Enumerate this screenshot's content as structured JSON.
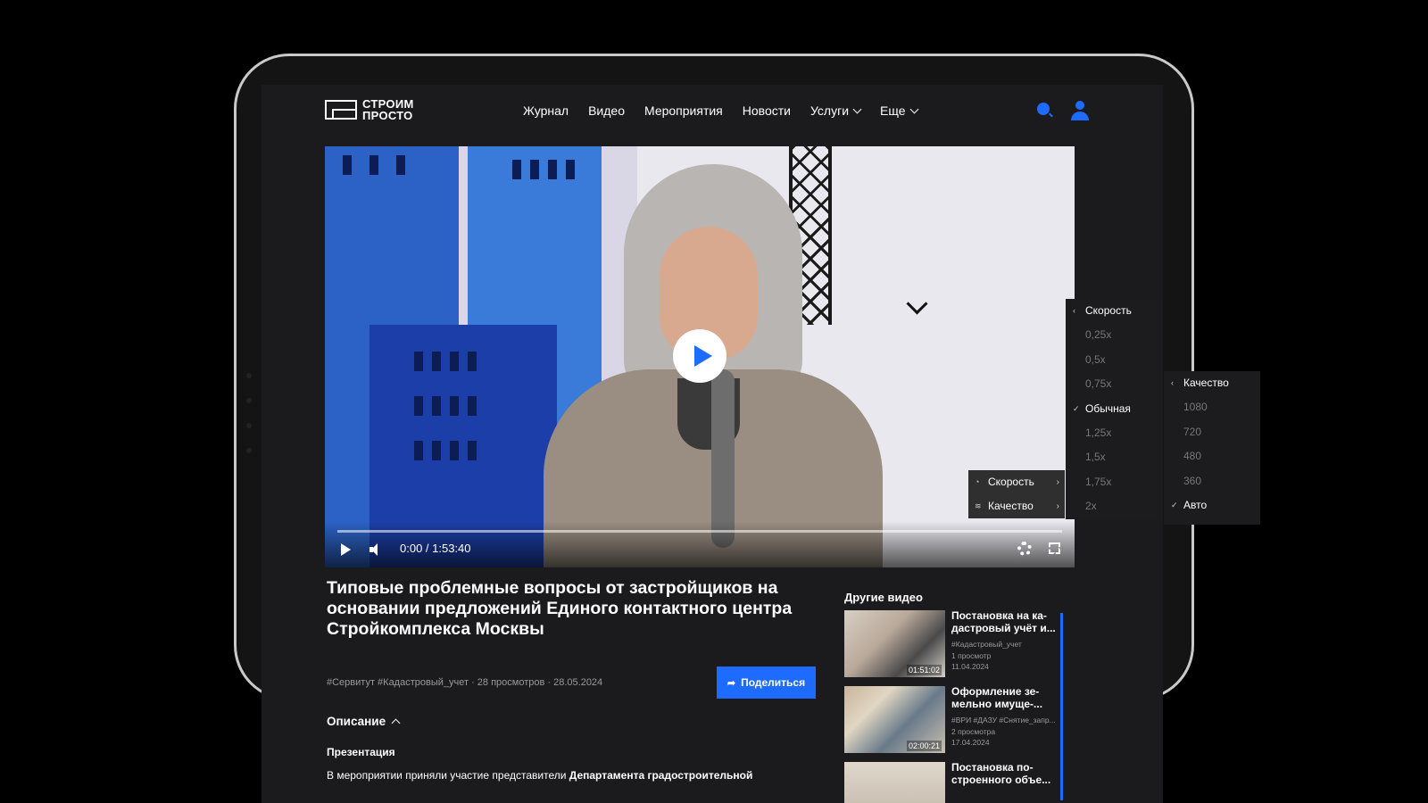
{
  "logo": {
    "line1": "СТРОИМ",
    "line2": "ПРОСТО"
  },
  "nav": {
    "items": [
      "Журнал",
      "Видео",
      "Мероприятия",
      "Новости"
    ],
    "services": "Услуги",
    "more": "Еще"
  },
  "player": {
    "time": "0:00 / 1:53:40",
    "settings_menu": {
      "speed": "Скорость",
      "quality": "Качество"
    }
  },
  "speed_menu": {
    "header": "Скорость",
    "options": [
      "0,25x",
      "0,5x",
      "0,75x",
      "Обычная",
      "1,25x",
      "1,5x",
      "1,75x",
      "2x"
    ],
    "selected": "Обычная"
  },
  "quality_menu": {
    "header": "Качество",
    "options": [
      "1080",
      "720",
      "480",
      "360",
      "Авто"
    ],
    "selected": "Авто"
  },
  "video": {
    "title": "Типовые проблемные вопросы от застройщиков на основании предложений Единого контактного центра Стройкомплекса Москвы",
    "meta": "#Сервитут #Кадастровый_учет · 28 просмотров · 28.05.2024",
    "share_label": "Поделиться",
    "description_label": "Описание",
    "presentation_label": "Презентация",
    "description_text_plain": "В мероприятии приняли участие представители ",
    "description_text_bold": "Департамента градостроительной"
  },
  "sidebar": {
    "title": "Другие видео",
    "items": [
      {
        "title": "Постановка на ка-дастровый учёт и...",
        "tags": "#Кадастровый_учет",
        "views": "1 просмотр",
        "date": "11.04.2024",
        "duration": "01:51:02"
      },
      {
        "title": "Оформление зе-мельно имуще-...",
        "tags": "#ВРИ #ДАЗУ #Снятие_запр...",
        "views": "2 просмотра",
        "date": "17.04.2024",
        "duration": "02:00:21"
      },
      {
        "title": "Постановка по-строенного объе...",
        "tags": "",
        "views": "",
        "date": "",
        "duration": ""
      }
    ]
  },
  "colors": {
    "accent": "#1e6bff",
    "background": "#1b1b1d"
  }
}
